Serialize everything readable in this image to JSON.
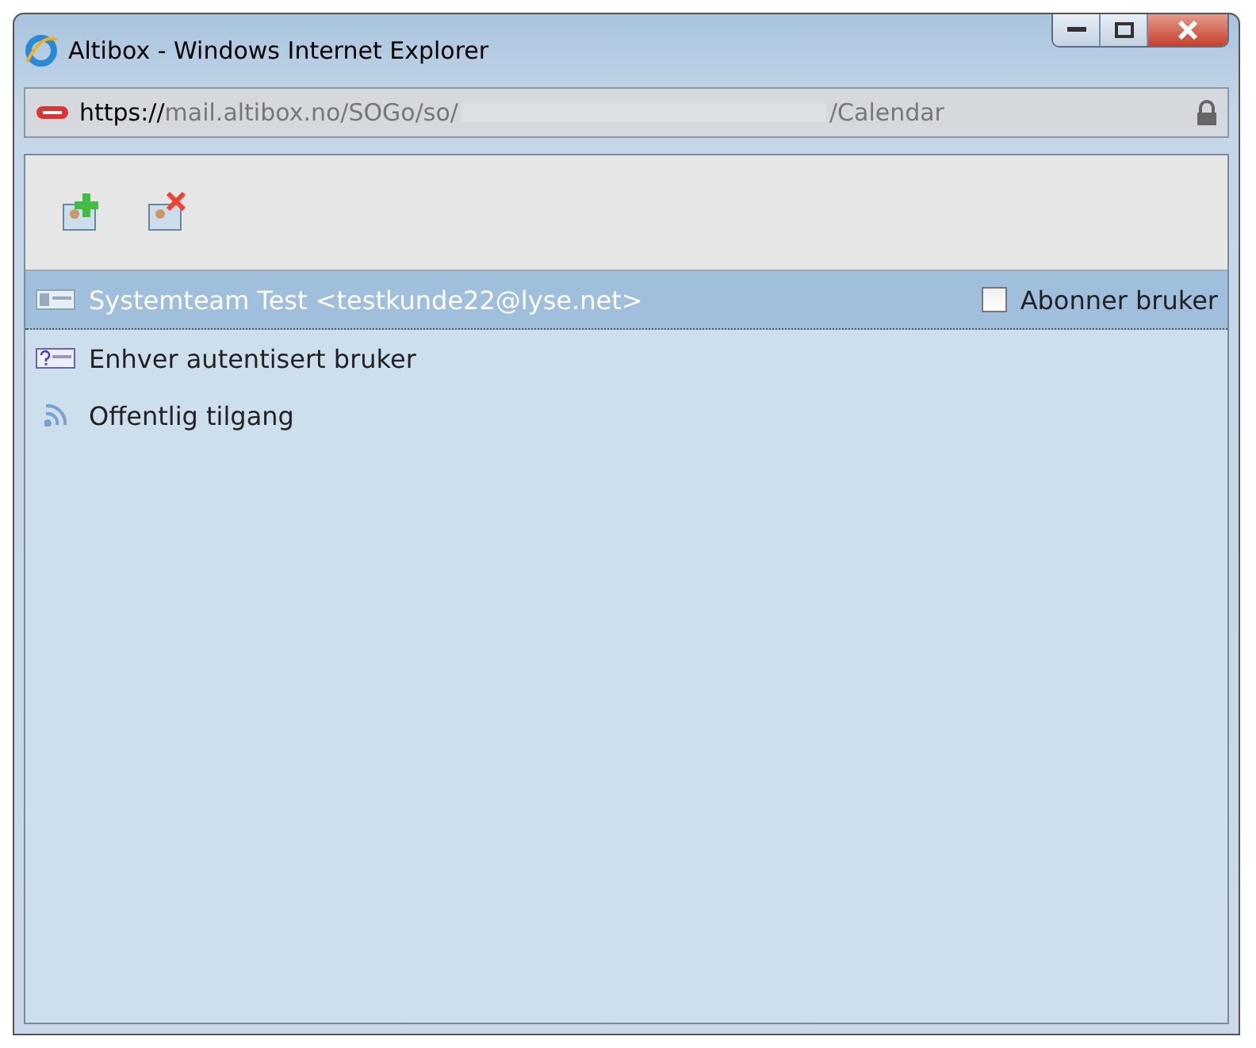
{
  "window": {
    "title": "Altibox - Windows Internet Explorer"
  },
  "address_bar": {
    "url_start": "https://",
    "url_host": "mail.altibox.no",
    "url_path": "/SOGo/so/",
    "url_end": "/Calendar"
  },
  "users": [
    {
      "kind": "user",
      "name": "Systemteam Test <testkunde22@lyse.net>",
      "selected": true,
      "subscribe": {
        "label": "Abonner bruker",
        "checked": false
      }
    },
    {
      "kind": "authenticated",
      "name": "Enhver autentisert bruker",
      "selected": false
    },
    {
      "kind": "public",
      "name": "Offentlig tilgang",
      "selected": false
    }
  ]
}
